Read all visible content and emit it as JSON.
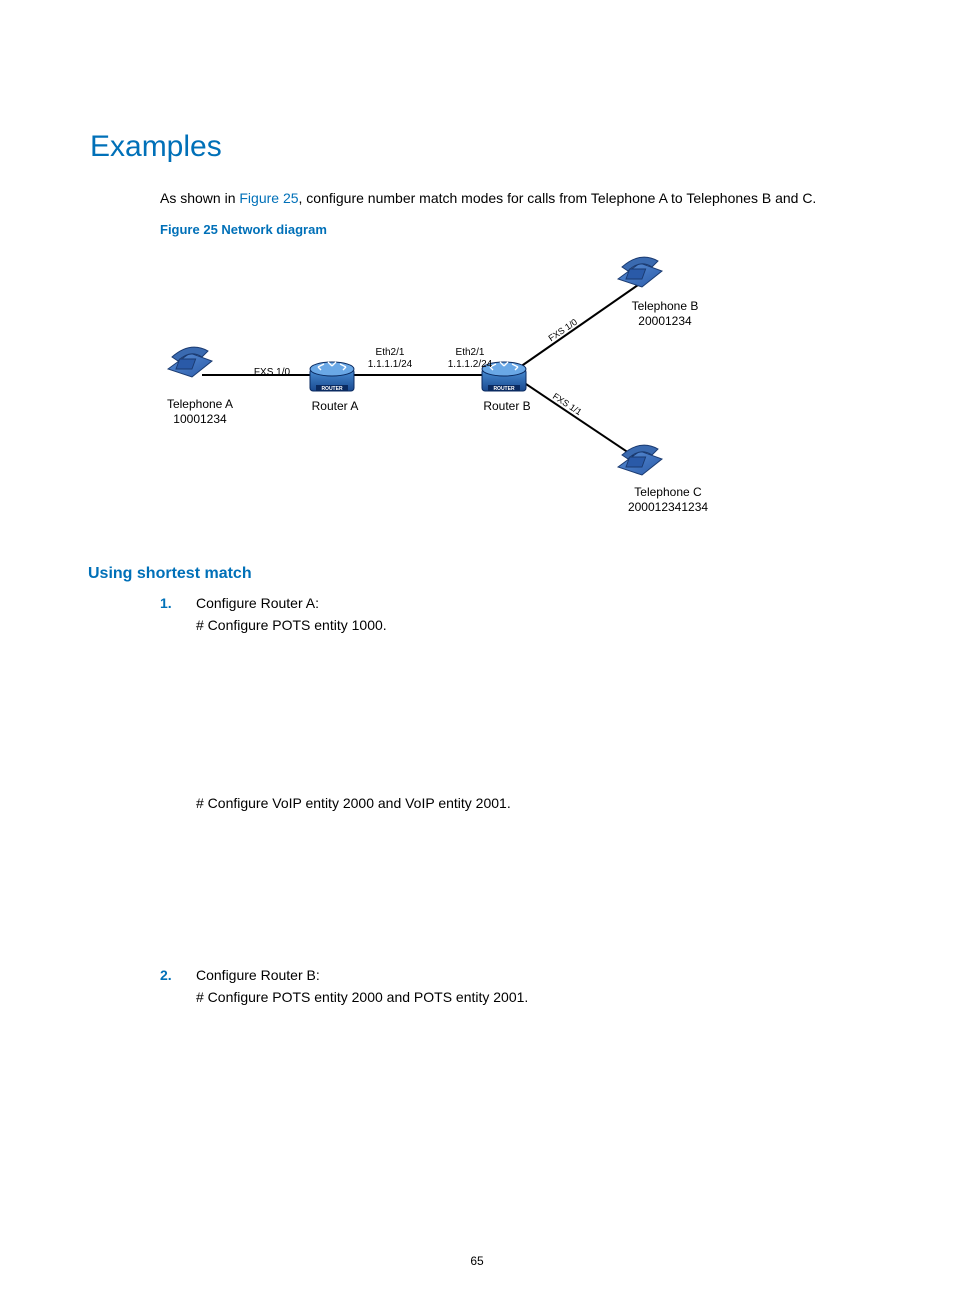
{
  "heading": "Examples",
  "intro_before": "As shown in ",
  "intro_link": "Figure 25",
  "intro_after": ", configure number match modes for calls from Telephone A to Telephones B and C.",
  "figure_caption": "Figure 25 Network diagram",
  "diagram": {
    "telA": {
      "name": "Telephone A",
      "num": "10001234"
    },
    "telB": {
      "name": "Telephone B",
      "num": "20001234"
    },
    "telC": {
      "name": "Telephone C",
      "num": "200012341234"
    },
    "routerA": "Router A",
    "routerB": "Router B",
    "fxs10": "FXS 1/0",
    "fxs10b": "FXS 1/0",
    "fxs11": "FXS 1/1",
    "ethA": {
      "l1": "Eth2/1",
      "l2": "1.1.1.1/24"
    },
    "ethB": {
      "l1": "Eth2/1",
      "l2": "1.1.1.2/24"
    }
  },
  "subheading": "Using shortest match",
  "steps": [
    {
      "num": "1.",
      "title": "Configure Router A:",
      "lines": [
        "# Configure POTS entity 1000.",
        "# Configure VoIP entity 2000 and VoIP entity 2001."
      ]
    },
    {
      "num": "2.",
      "title": "Configure Router B:",
      "lines": [
        "# Configure POTS entity 2000 and POTS entity 2001."
      ]
    }
  ],
  "page_number": "65"
}
